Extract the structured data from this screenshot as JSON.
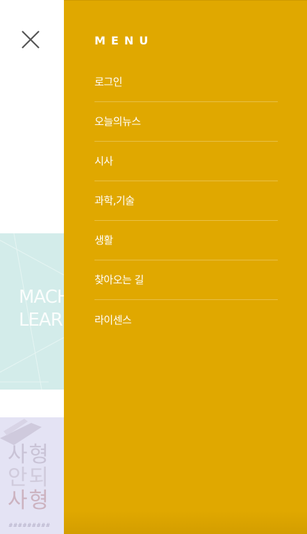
{
  "menu": {
    "title": "MENU",
    "items": [
      {
        "label": "로그인"
      },
      {
        "label": "오늘의뉴스"
      },
      {
        "label": "시사"
      },
      {
        "label": "과학,기술"
      },
      {
        "label": "생활"
      },
      {
        "label": "찾아오는 길"
      },
      {
        "label": "라이센스"
      }
    ]
  },
  "background": {
    "card_1": {
      "line_1": "MACH",
      "line_2": "LEARN"
    },
    "card_2": {
      "line_1": "사형",
      "line_2": "안되",
      "line_3": "사형",
      "footnote": "#########"
    }
  },
  "icons": {
    "close": "close-icon"
  },
  "colors": {
    "menu_background": "#e0a800",
    "menu_text": "#ffffff",
    "card_1_background": "#d3ecea",
    "card_2_background": "#e4e3f4",
    "close_icon": "#555555"
  }
}
